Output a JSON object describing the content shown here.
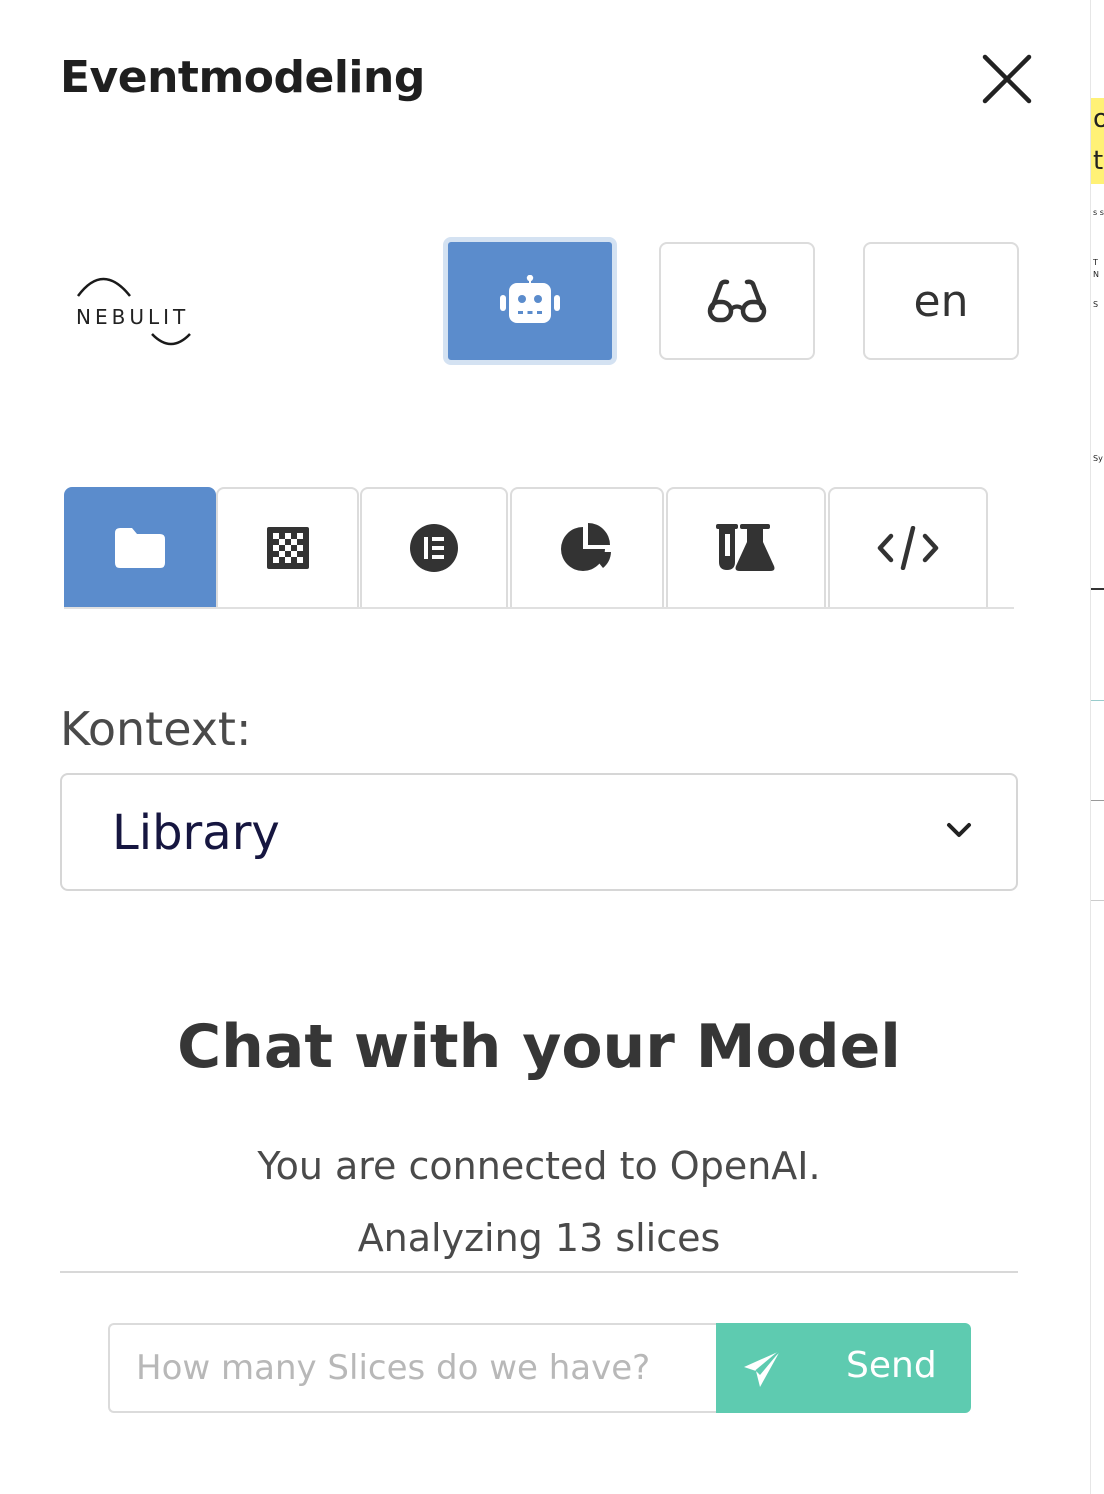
{
  "header": {
    "title": "Eventmodeling"
  },
  "logo": {
    "text": "NEBULIT"
  },
  "toolbar": {
    "language": "en"
  },
  "context": {
    "label": "Kontext:",
    "selected": "Library"
  },
  "chat": {
    "title": "Chat with your Model",
    "connection": "You are connected to OpenAI.",
    "analyzing": "Analyzing 13 slices",
    "input_placeholder": "How many Slices do we have?",
    "send_label": "Send"
  },
  "colors": {
    "accent": "#5b8ccc",
    "send": "#5ecbb0",
    "highlight": "#fff176"
  }
}
